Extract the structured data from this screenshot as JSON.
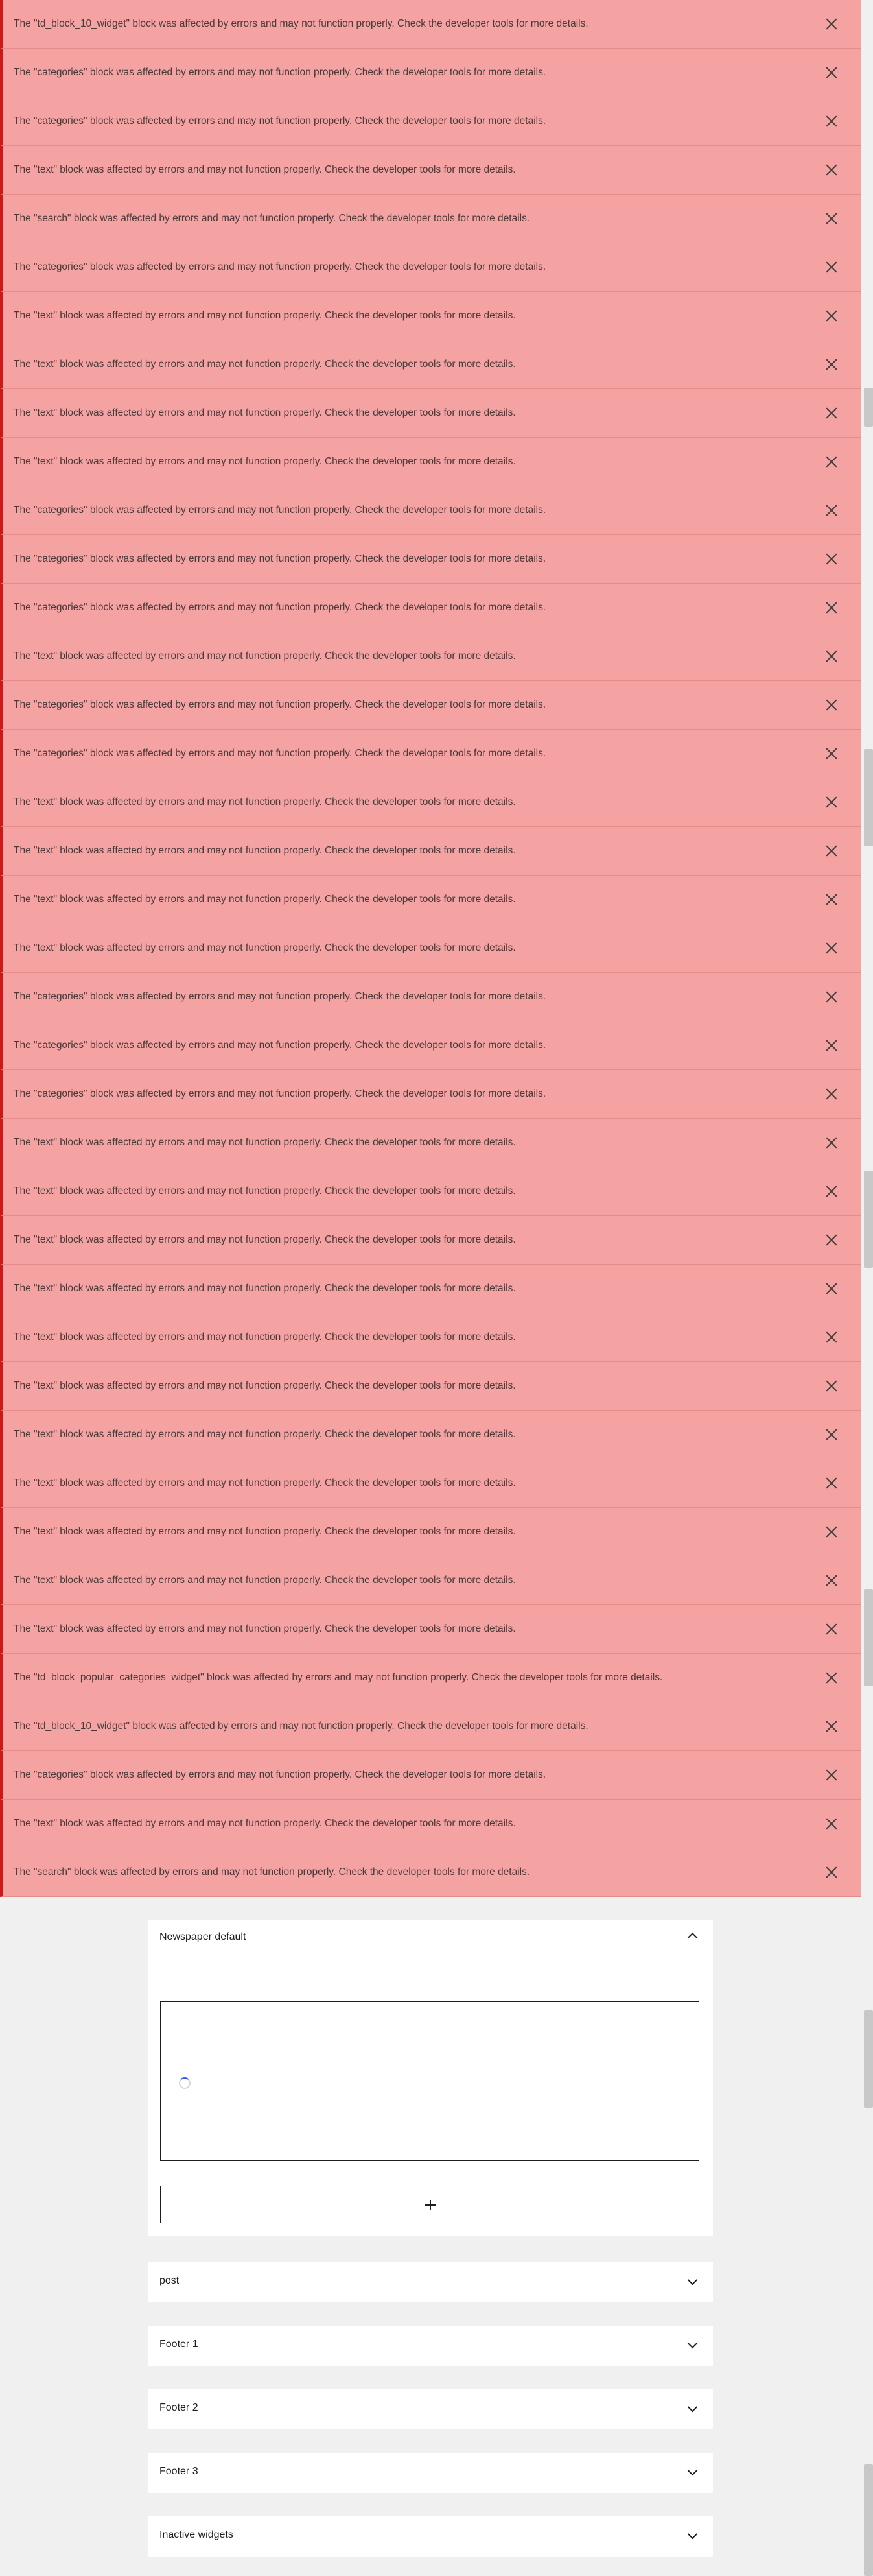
{
  "notices": [
    "The \"td_block_10_widget\" block was affected by errors and may not function properly. Check the developer tools for more details.",
    "The \"categories\" block was affected by errors and may not function properly. Check the developer tools for more details.",
    "The \"categories\" block was affected by errors and may not function properly. Check the developer tools for more details.",
    "The \"text\" block was affected by errors and may not function properly. Check the developer tools for more details.",
    "The \"search\" block was affected by errors and may not function properly. Check the developer tools for more details.",
    "The \"categories\" block was affected by errors and may not function properly. Check the developer tools for more details.",
    "The \"text\" block was affected by errors and may not function properly. Check the developer tools for more details.",
    "The \"text\" block was affected by errors and may not function properly. Check the developer tools for more details.",
    "The \"text\" block was affected by errors and may not function properly. Check the developer tools for more details.",
    "The \"text\" block was affected by errors and may not function properly. Check the developer tools for more details.",
    "The \"categories\" block was affected by errors and may not function properly. Check the developer tools for more details.",
    "The \"categories\" block was affected by errors and may not function properly. Check the developer tools for more details.",
    "The \"categories\" block was affected by errors and may not function properly. Check the developer tools for more details.",
    "The \"text\" block was affected by errors and may not function properly. Check the developer tools for more details.",
    "The \"categories\" block was affected by errors and may not function properly. Check the developer tools for more details.",
    "The \"categories\" block was affected by errors and may not function properly. Check the developer tools for more details.",
    "The \"text\" block was affected by errors and may not function properly. Check the developer tools for more details.",
    "The \"text\" block was affected by errors and may not function properly. Check the developer tools for more details.",
    "The \"text\" block was affected by errors and may not function properly. Check the developer tools for more details.",
    "The \"text\" block was affected by errors and may not function properly. Check the developer tools for more details.",
    "The \"categories\" block was affected by errors and may not function properly. Check the developer tools for more details.",
    "The \"categories\" block was affected by errors and may not function properly. Check the developer tools for more details.",
    "The \"categories\" block was affected by errors and may not function properly. Check the developer tools for more details.",
    "The \"text\" block was affected by errors and may not function properly. Check the developer tools for more details.",
    "The \"text\" block was affected by errors and may not function properly. Check the developer tools for more details.",
    "The \"text\" block was affected by errors and may not function properly. Check the developer tools for more details.",
    "The \"text\" block was affected by errors and may not function properly. Check the developer tools for more details.",
    "The \"text\" block was affected by errors and may not function properly. Check the developer tools for more details.",
    "The \"text\" block was affected by errors and may not function properly. Check the developer tools for more details.",
    "The \"text\" block was affected by errors and may not function properly. Check the developer tools for more details.",
    "The \"text\" block was affected by errors and may not function properly. Check the developer tools for more details.",
    "The \"text\" block was affected by errors and may not function properly. Check the developer tools for more details.",
    "The \"text\" block was affected by errors and may not function properly. Check the developer tools for more details.",
    "The \"text\" block was affected by errors and may not function properly. Check the developer tools for more details.",
    "The \"td_block_popular_categories_widget\" block was affected by errors and may not function properly. Check the developer tools for more details.",
    "The \"td_block_10_widget\" block was affected by errors and may not function properly. Check the developer tools for more details.",
    "The \"categories\" block was affected by errors and may not function properly. Check the developer tools for more details.",
    "The \"text\" block was affected by errors and may not function properly. Check the developer tools for more details.",
    "The \"search\" block was affected by errors and may not function properly. Check the developer tools for more details."
  ],
  "close_icon": "close-icon",
  "widget_areas": {
    "open": {
      "title": "Newspaper default",
      "toggle_icon": "chevron-up-icon",
      "add_block_icon": "plus-icon"
    },
    "collapsed": [
      {
        "title": "post",
        "toggle_icon": "chevron-down-icon"
      },
      {
        "title": "Footer 1",
        "toggle_icon": "chevron-down-icon"
      },
      {
        "title": "Footer 2",
        "toggle_icon": "chevron-down-icon"
      },
      {
        "title": "Footer 3",
        "toggle_icon": "chevron-down-icon"
      },
      {
        "title": "Inactive widgets",
        "toggle_icon": "chevron-down-icon"
      }
    ]
  },
  "colors": {
    "notice_bg": "#f4a2a2",
    "notice_border": "#cc1818",
    "spinner": "#3858e9"
  }
}
